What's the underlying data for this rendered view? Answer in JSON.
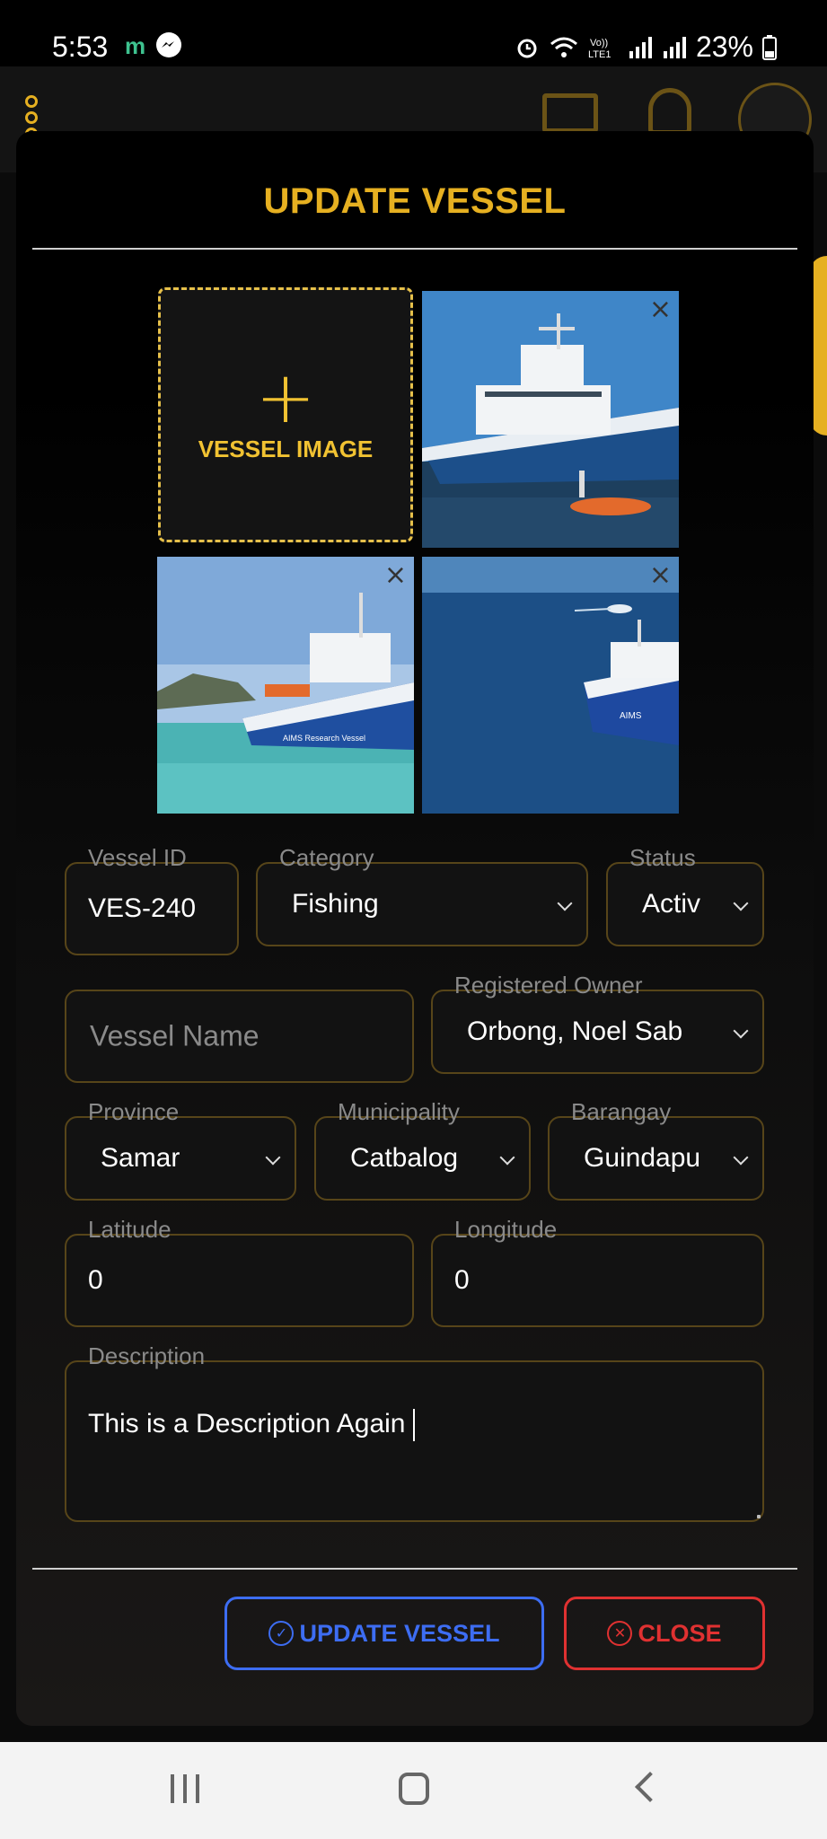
{
  "status_bar": {
    "time": "5:53",
    "messenger_m": "m",
    "volte_label": "Vo)) LTE1",
    "battery": "23%"
  },
  "background_app": {
    "menu_icon": "three-dots-vertical-icon",
    "icons": [
      "mail-icon",
      "bell-icon",
      "avatar"
    ],
    "accent_color": "#e6b021"
  },
  "modal": {
    "title": "UPDATE VESSEL",
    "add_image_label": "VESSEL IMAGE",
    "images": [
      {
        "alt": "Research vessel docked on blue water with small orange boat"
      },
      {
        "alt": "AIMS Research Vessel near green hills"
      },
      {
        "alt": "Aerial view of AIMS vessel on deep blue ocean"
      }
    ],
    "fields": {
      "vessel_id": {
        "label": "Vessel ID",
        "value": "VES-240"
      },
      "category": {
        "label": "Category",
        "value": "Fishing"
      },
      "status": {
        "label": "Status",
        "value": "Activ"
      },
      "vessel_name": {
        "label": "Vessel Name",
        "placeholder": "Vessel Name"
      },
      "registered_owner": {
        "label": "Registered Owner",
        "value": "Orbong, Noel Sab"
      },
      "province": {
        "label": "Province",
        "value": "Samar"
      },
      "municipality": {
        "label": "Municipality",
        "value": "Catbalog"
      },
      "barangay": {
        "label": "Barangay",
        "value": "Guindapu"
      },
      "latitude": {
        "label": "Latitude",
        "value": "0"
      },
      "longitude": {
        "label": "Longitude",
        "value": "0"
      },
      "description": {
        "label": "Description",
        "value": "This is a Description Again"
      }
    },
    "buttons": {
      "update": "UPDATE VESSEL",
      "close": "CLOSE"
    }
  },
  "colors": {
    "gold": "#e6b021",
    "field_border": "#574519",
    "update_blue": "#3d6df2",
    "close_red": "#e03131"
  }
}
